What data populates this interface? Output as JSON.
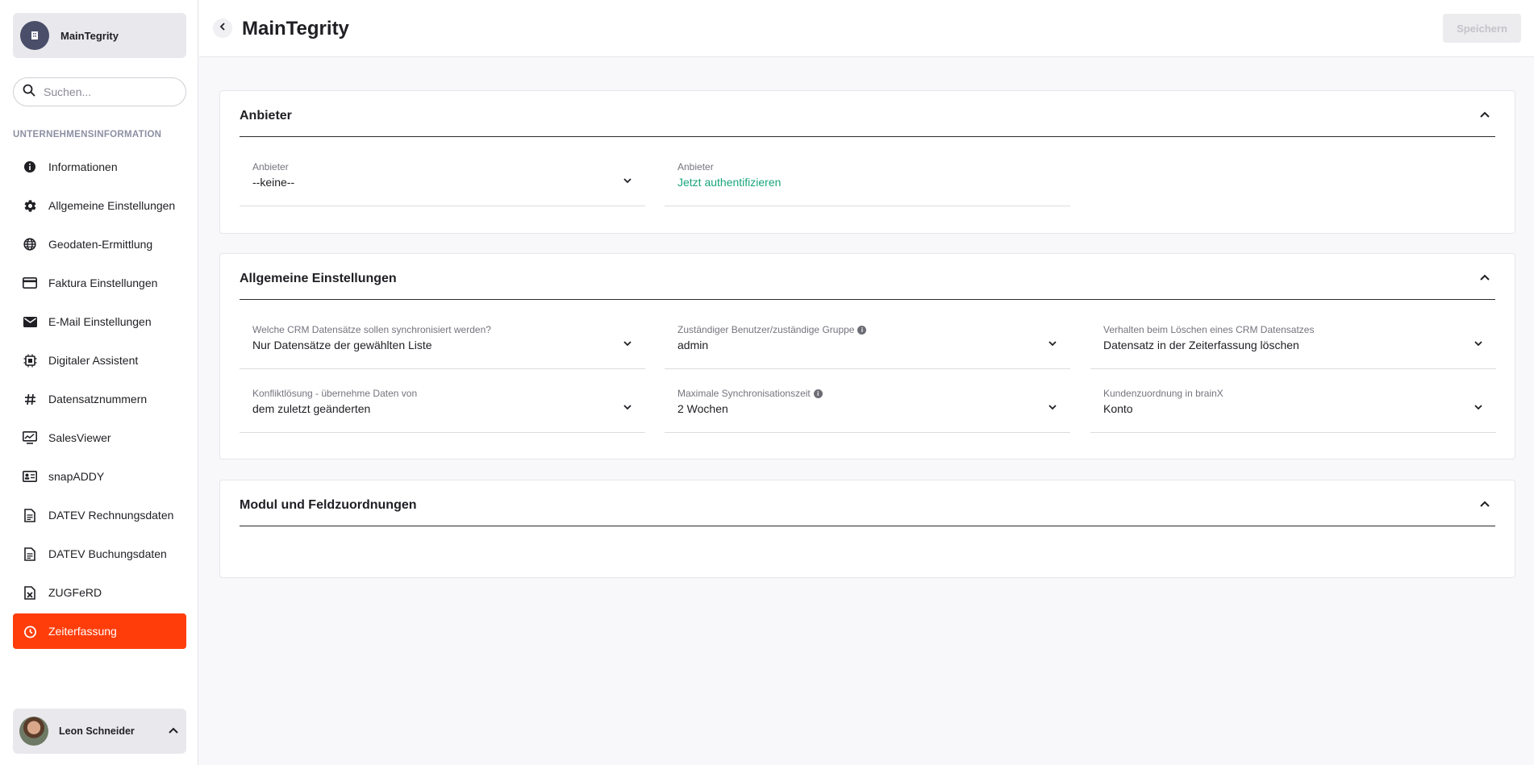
{
  "company": {
    "name": "MainTegrity"
  },
  "search": {
    "placeholder": "Suchen..."
  },
  "sidebar": {
    "section_label": "UNTERNEHMENSINFORMATION",
    "items": [
      {
        "label": "Informationen",
        "icon": "info-icon"
      },
      {
        "label": "Allgemeine Einstellungen",
        "icon": "gear-icon"
      },
      {
        "label": "Geodaten-Ermittlung",
        "icon": "globe-icon"
      },
      {
        "label": "Faktura Einstellungen",
        "icon": "credit-card-icon"
      },
      {
        "label": "E-Mail Einstellungen",
        "icon": "mail-icon"
      },
      {
        "label": "Digitaler Assistent",
        "icon": "chip-icon"
      },
      {
        "label": "Datensatznummern",
        "icon": "hash-icon"
      },
      {
        "label": "SalesViewer",
        "icon": "monitor-chart-icon"
      },
      {
        "label": "snapADDY",
        "icon": "id-card-icon"
      },
      {
        "label": "DATEV Rechnungsdaten",
        "icon": "document-icon"
      },
      {
        "label": "DATEV Buchungsdaten",
        "icon": "document-icon"
      },
      {
        "label": "ZUGFeRD",
        "icon": "excel-file-icon"
      },
      {
        "label": "Zeiterfassung",
        "icon": "timer-icon",
        "active": true
      }
    ]
  },
  "user": {
    "name": "Leon Schneider"
  },
  "header": {
    "title": "MainTegrity",
    "save_label": "Speichern"
  },
  "sections": {
    "anbieter": {
      "title": "Anbieter",
      "fields": [
        {
          "label": "Anbieter",
          "value": "--keine--"
        },
        {
          "label": "Anbieter",
          "value": "Jetzt authentifizieren"
        }
      ]
    },
    "allgemein": {
      "title": "Allgemeine Einstellungen",
      "fields": [
        {
          "label": "Welche CRM Datensätze sollen synchronisiert werden?",
          "value": "Nur Datensätze der gewählten Liste"
        },
        {
          "label": "Zuständiger Benutzer/zuständige Gruppe",
          "value": "admin"
        },
        {
          "label": "Verhalten beim Löschen eines CRM Datensatzes",
          "value": "Datensatz in der Zeiterfassung löschen"
        },
        {
          "label": "Konfliktlösung - übernehme Daten von",
          "value": "dem zuletzt geänderten"
        },
        {
          "label": "Maximale Synchronisationszeit",
          "value": "2 Wochen"
        },
        {
          "label": "Kundenzuordnung in brainX",
          "value": "Konto"
        }
      ]
    },
    "modul": {
      "title": "Modul und Feldzuordnungen"
    }
  },
  "colors": {
    "accent": "#ff3d0a",
    "link": "#1aa57b"
  }
}
